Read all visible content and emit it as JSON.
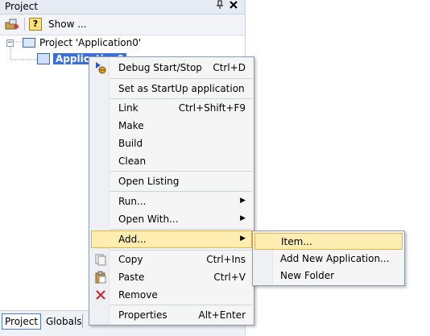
{
  "panel": {
    "title": "Project",
    "pin_glyph": "⊑",
    "close_glyph": "✕"
  },
  "toolbar": {
    "show_label": "Show ..."
  },
  "tree": {
    "project_label": "Project 'Application0'",
    "app_label": "Application0"
  },
  "context_menu": {
    "debug": {
      "label": "Debug Start/Stop",
      "shortcut": "Ctrl+D"
    },
    "startup": {
      "label": "Set as StartUp application"
    },
    "link": {
      "label": "Link",
      "shortcut": "Ctrl+Shift+F9"
    },
    "make": {
      "label": "Make"
    },
    "build": {
      "label": "Build"
    },
    "clean": {
      "label": "Clean"
    },
    "open_listing": {
      "label": "Open Listing"
    },
    "run": {
      "label": "Run..."
    },
    "open_with": {
      "label": "Open With..."
    },
    "add": {
      "label": "Add..."
    },
    "copy": {
      "label": "Copy",
      "shortcut": "Ctrl+Ins"
    },
    "paste": {
      "label": "Paste",
      "shortcut": "Ctrl+V"
    },
    "remove": {
      "label": "Remove"
    },
    "properties": {
      "label": "Properties",
      "shortcut": "Alt+Enter"
    }
  },
  "add_submenu": {
    "item": "Item...",
    "add_new_application": "Add New Application...",
    "new_folder": "New Folder"
  },
  "bottom_tabs": {
    "project": "Project",
    "globals": "Globals"
  },
  "colors": {
    "highlight": "#fdedb0",
    "selection": "#3a6fd8"
  }
}
